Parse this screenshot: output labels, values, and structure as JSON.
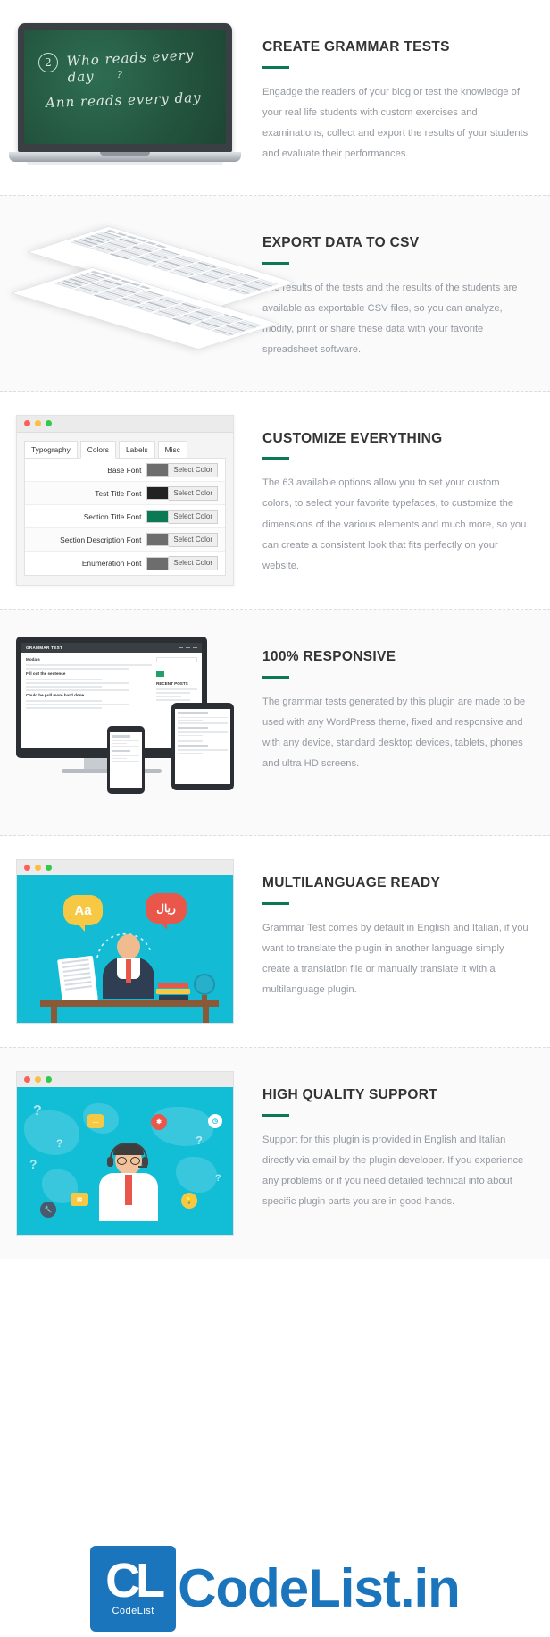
{
  "brand": {
    "accent_green": "#0b7a54",
    "muted_text": "#9499a0",
    "heading_text": "#333333",
    "teal": "#13bcd4",
    "watermark_blue": "#1b75bc"
  },
  "watermark": {
    "badge_letters": "CL",
    "badge_sub": "CodeList",
    "text": "CodeList.in"
  },
  "features": [
    {
      "id": "create-grammar-tests",
      "title": "CREATE GRAMMAR TESTS",
      "body": "Engadge the readers of your blog or test the knowledge of your real life students with custom exercises and examinations, collect and export the results of your students and evaluate their performances.",
      "media": "laptop-chalkboard",
      "chalkboard": {
        "number": "2",
        "line1": "Who reads every day",
        "line2": "?",
        "line3": "Ann reads every day"
      }
    },
    {
      "id": "export-data-to-csv",
      "title": "EXPORT DATA TO CSV",
      "body": "The results  of the tests and the results of the students are available as exportable CSV files, so you can analyze, modify, print or share these data with your favorite spreadsheet software.",
      "media": "csv-spreadsheets"
    },
    {
      "id": "customize-everything",
      "title": "CUSTOMIZE EVERYTHING",
      "body": "The 63 available options allow you to set your custom colors, to select your favorite typefaces, to customize the dimensions of the various elements and much more, so you can create a consistent look that fits perfectly on your website.",
      "media": "settings-window"
    },
    {
      "id": "100-responsive",
      "title": "100% RESPONSIVE",
      "body": "The grammar tests generated by this plugin are made to be used with any WordPress theme, fixed and responsive and with any device, standard desktop devices, tablets, phones and ultra HD screens.",
      "media": "devices"
    },
    {
      "id": "multilanguage-ready",
      "title": "MULTILANGUAGE READY",
      "body": "Grammar Test comes by default in English and Italian, if you want to translate the plugin in another language simply create a translation file or manually translate it with a multilanguage plugin.",
      "media": "multilanguage-illustration"
    },
    {
      "id": "high-quality-support",
      "title": "HIGH QUALITY SUPPORT",
      "body": "Support for this plugin is provided in English and Italian directly via email by the plugin developer. If you experience any problems or if you need detailed technical info about specific plugin parts you are in good hands.",
      "media": "support-illustration"
    }
  ],
  "settings_window": {
    "window_dots": [
      "red",
      "yellow",
      "green"
    ],
    "tabs": [
      {
        "label": "Typography",
        "active": false
      },
      {
        "label": "Colors",
        "active": true
      },
      {
        "label": "Labels",
        "active": false
      },
      {
        "label": "Misc",
        "active": false
      }
    ],
    "button_label": "Select Color",
    "rows": [
      {
        "label": "Base Font",
        "color": "#6d6d6d"
      },
      {
        "label": "Test Title Font",
        "color": "#222222"
      },
      {
        "label": "Section Title Font",
        "color": "#0b7a54"
      },
      {
        "label": "Section Description Font",
        "color": "#6d6d6d"
      },
      {
        "label": "Enumeration Font",
        "color": "#6d6d6d"
      }
    ]
  },
  "device_preview": {
    "logo": "GRAMMAR TEST",
    "heading": "Modals",
    "sidebar_heading": "RECENT POSTS",
    "subheading_1": "Fill out the sentence",
    "subheading_2": "Could he pull more hard done"
  },
  "multilanguage_illustration": {
    "bubble_left": "Aa",
    "bubble_right": "ريال"
  },
  "support_illustration": {
    "question_marks": [
      "?",
      "?",
      "?",
      "?",
      "?"
    ]
  }
}
